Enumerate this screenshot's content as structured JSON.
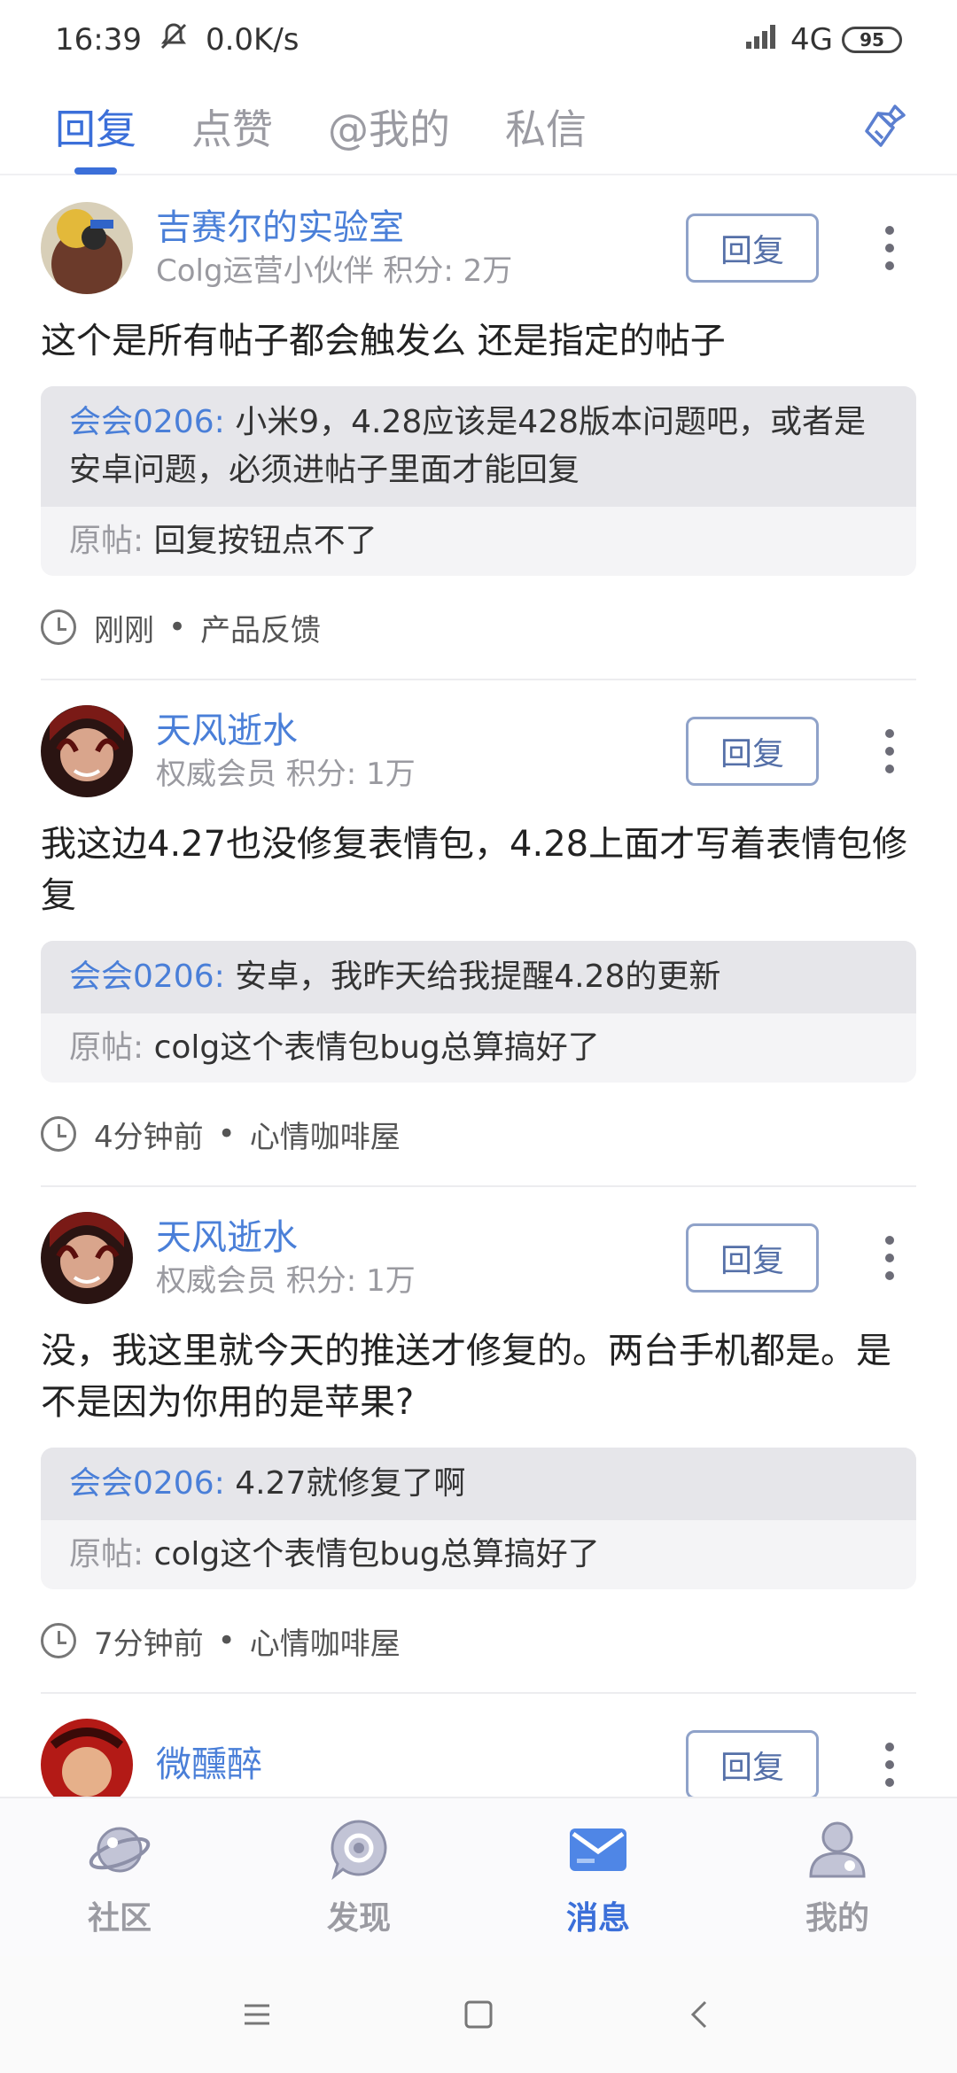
{
  "status_bar": {
    "time": "16:39",
    "speed": "0.0K/s",
    "network": "4G",
    "battery": "95"
  },
  "tabs": [
    {
      "label": "回复",
      "active": true
    },
    {
      "label": "点赞",
      "active": false
    },
    {
      "label": "@我的",
      "active": false
    },
    {
      "label": "私信",
      "active": false
    }
  ],
  "reply_button_label": "回复",
  "quote_prefix": "原帖:",
  "posts": [
    {
      "user_name": "吉赛尔的实验室",
      "user_meta": "Colg运营小伙伴 积分: 2万",
      "content": "这个是所有帖子都会触发么 还是指定的帖子",
      "quote_name": "会会0206:",
      "quote_text": "小米9，4.28应该是428版本问题吧，或者是安卓问题，必须进帖子里面才能回复",
      "origin_text": "回复按钮点不了",
      "time": "刚刚",
      "forum": "产品反馈"
    },
    {
      "user_name": "天风逝水",
      "user_meta": "权威会员 积分: 1万",
      "content": "我这边4.27也没修复表情包，4.28上面才写着表情包修复",
      "quote_name": "会会0206:",
      "quote_text": "安卓，我昨天给我提醒4.28的更新",
      "origin_text": "colg这个表情包bug总算搞好了",
      "time": "4分钟前",
      "forum": "心情咖啡屋"
    },
    {
      "user_name": "天风逝水",
      "user_meta": "权威会员 积分: 1万",
      "content": "没，我这里就今天的推送才修复的。两台手机都是。是不是因为你用的是苹果?",
      "quote_name": "会会0206:",
      "quote_text": "4.27就修复了啊",
      "origin_text": "colg这个表情包bug总算搞好了",
      "time": "7分钟前",
      "forum": "心情咖啡屋"
    },
    {
      "user_name": "微醺醉",
      "user_meta": "",
      "content": "",
      "time": "",
      "forum": ""
    }
  ],
  "bottom_nav": [
    {
      "label": "社区",
      "icon": "planet-icon",
      "active": false
    },
    {
      "label": "发现",
      "icon": "discover-icon",
      "active": false
    },
    {
      "label": "消息",
      "icon": "mail-icon",
      "active": true
    },
    {
      "label": "我的",
      "icon": "profile-icon",
      "active": false
    }
  ],
  "colors": {
    "accent": "#3b6fd9",
    "username": "#4a7fd8"
  }
}
